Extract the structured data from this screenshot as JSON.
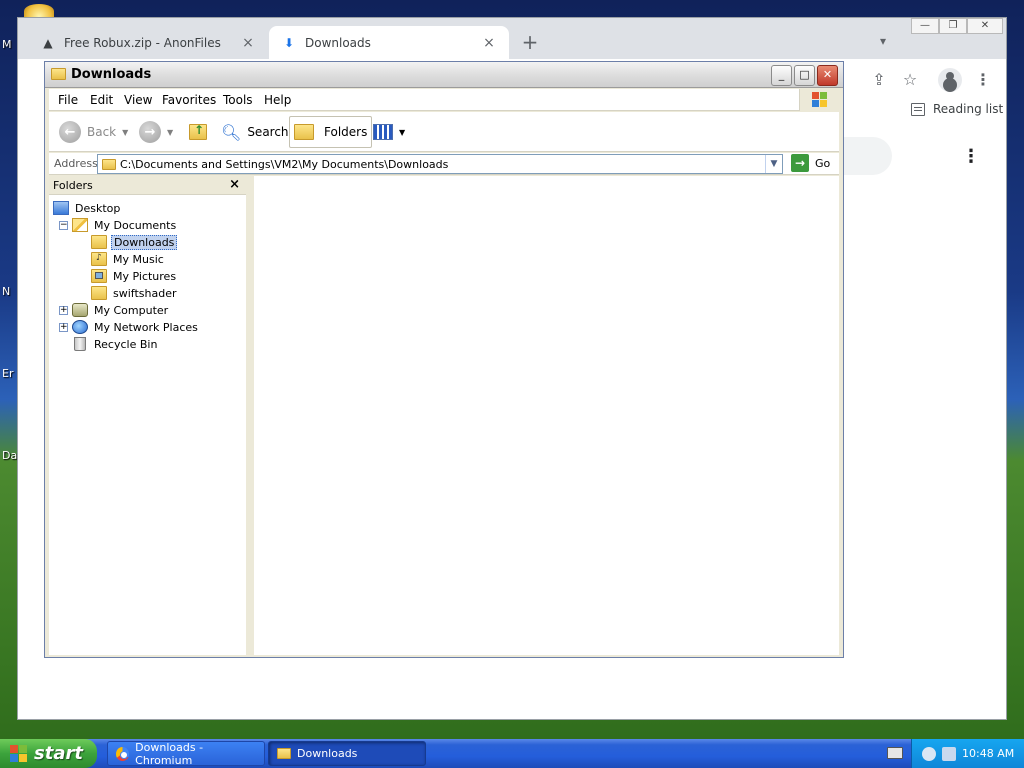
{
  "desktop": {
    "labels": [
      "M",
      "N",
      "Er",
      "Da"
    ]
  },
  "chrome": {
    "tabs": [
      {
        "title": "Free Robux.zip - AnonFiles",
        "active": false
      },
      {
        "title": "Downloads",
        "active": true
      }
    ],
    "new_tab_glyph": "+",
    "close_glyph": "×",
    "reading_list_label": "Reading list"
  },
  "explorer": {
    "title": "Downloads",
    "menu": [
      "File",
      "Edit",
      "View",
      "Favorites",
      "Tools",
      "Help"
    ],
    "toolbar": {
      "back_label": "Back",
      "search_label": "Search",
      "folders_label": "Folders"
    },
    "address": {
      "label": "Address",
      "value": "C:\\Documents and Settings\\VM2\\My Documents\\Downloads",
      "go_label": "Go"
    },
    "folders_pane": {
      "header": "Folders",
      "close_glyph": "×",
      "tree": [
        {
          "label": "Desktop",
          "icon": "desktop-icon"
        },
        {
          "label": "My Documents",
          "icon": "my-documents-icon",
          "expander": "−"
        },
        {
          "label": "Downloads",
          "icon": "folder-icon",
          "selected": true
        },
        {
          "label": "My Music",
          "icon": "my-music-folder-icon"
        },
        {
          "label": "My Pictures",
          "icon": "my-pictures-folder-icon"
        },
        {
          "label": "swiftshader",
          "icon": "folder-icon"
        },
        {
          "label": "My Computer",
          "icon": "my-computer-icon",
          "expander": "+"
        },
        {
          "label": "My Network Places",
          "icon": "network-places-icon",
          "expander": "+"
        },
        {
          "label": "Recycle Bin",
          "icon": "recycle-bin-icon"
        }
      ]
    }
  },
  "taskbar": {
    "start_label": "start",
    "buttons": [
      {
        "label": "Downloads - Chromium",
        "active": false
      },
      {
        "label": "Downloads",
        "active": true
      }
    ],
    "clock": "10:48 AM"
  }
}
